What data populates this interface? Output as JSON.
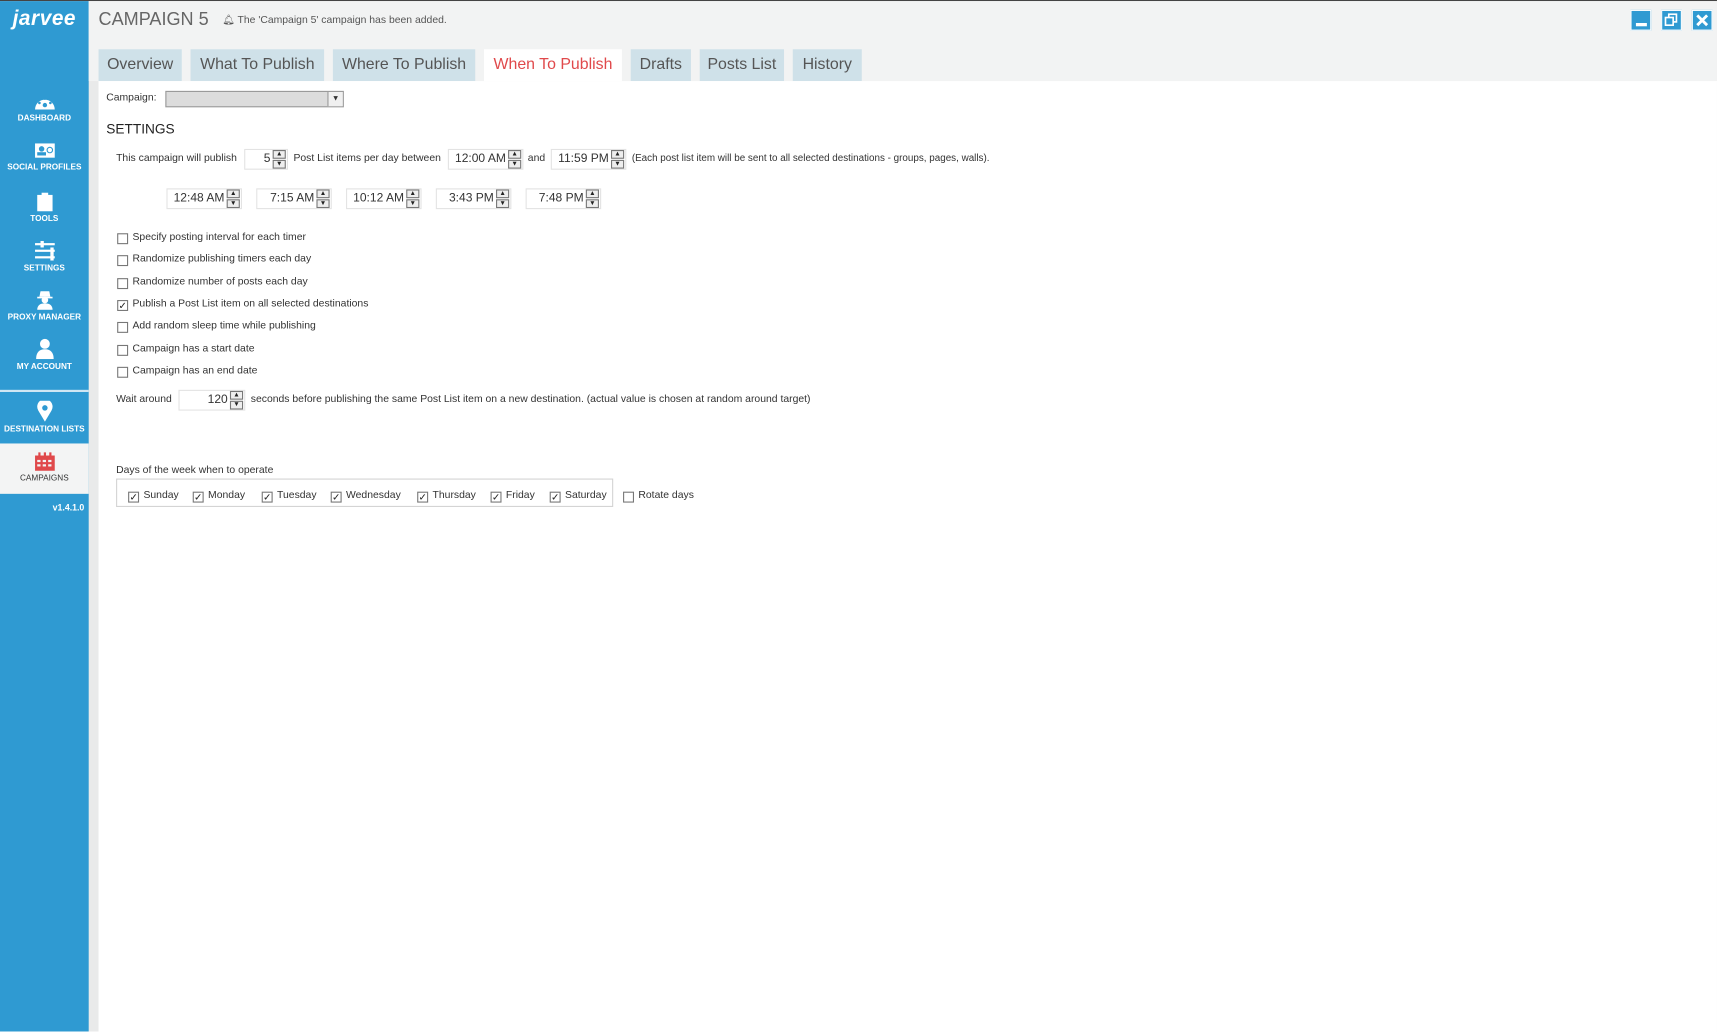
{
  "app": {
    "logo": "jarvee",
    "title": "CAMPAIGN 5",
    "notification": "The 'Campaign 5' campaign has been added.",
    "version": "v1.4.1.0",
    "accent": "#2f9ad2",
    "active_tab_color": "#e0494b"
  },
  "sidebar": {
    "items": [
      {
        "label": "DASHBOARD",
        "icon": "dashboard-icon"
      },
      {
        "label": "SOCIAL PROFILES",
        "icon": "social-profiles-icon"
      },
      {
        "label": "TOOLS",
        "icon": "clipboard-icon"
      },
      {
        "label": "SETTINGS",
        "icon": "sliders-icon"
      },
      {
        "label": "PROXY MANAGER",
        "icon": "spy-icon"
      },
      {
        "label": "MY ACCOUNT",
        "icon": "user-icon"
      },
      {
        "label": "DESTINATION LISTS",
        "icon": "map-pin-icon"
      },
      {
        "label": "CAMPAIGNS",
        "icon": "calendar-icon",
        "active": true
      }
    ]
  },
  "tabs": [
    "Overview",
    "What To Publish",
    "Where To Publish",
    "When To Publish",
    "Drafts",
    "Posts List",
    "History"
  ],
  "active_tab": "When To Publish",
  "campaign": {
    "label": "Campaign:",
    "value": ""
  },
  "settings": {
    "heading": "SETTINGS",
    "publish_prefix": "This campaign will publish",
    "posts_per_day": "5",
    "publish_middle": "Post List items per day between",
    "start_time": "12:00 AM",
    "and": "and",
    "end_time": "11:59 PM",
    "note": "(Each post list item will be sent to all selected destinations - groups, pages, walls).",
    "timers": [
      "12:48 AM",
      "7:15 AM",
      "10:12 AM",
      "3:43 PM",
      "7:48 PM"
    ],
    "options": [
      {
        "label": "Specify posting interval for each timer",
        "checked": false
      },
      {
        "label": "Randomize publishing timers each day",
        "checked": false
      },
      {
        "label": "Randomize number of posts each day",
        "checked": false
      },
      {
        "label": "Publish a Post List item on all selected destinations",
        "checked": true
      },
      {
        "label": "Add random sleep time while publishing",
        "checked": false
      },
      {
        "label": "Campaign has a start date",
        "checked": false
      },
      {
        "label": "Campaign has an end date",
        "checked": false
      }
    ],
    "wait_label": "Wait around",
    "wait_seconds": "120",
    "wait_suffix": "seconds before publishing the same Post List item on a new destination. (actual value is chosen at random around target)"
  },
  "days": {
    "label": "Days of the week when to operate",
    "items": [
      {
        "label": "Sunday",
        "checked": true
      },
      {
        "label": "Monday",
        "checked": true
      },
      {
        "label": "Tuesday",
        "checked": true
      },
      {
        "label": "Wednesday",
        "checked": true
      },
      {
        "label": "Thursday",
        "checked": true
      },
      {
        "label": "Friday",
        "checked": true
      },
      {
        "label": "Saturday",
        "checked": true
      }
    ],
    "rotate": {
      "label": "Rotate days",
      "checked": false
    }
  }
}
